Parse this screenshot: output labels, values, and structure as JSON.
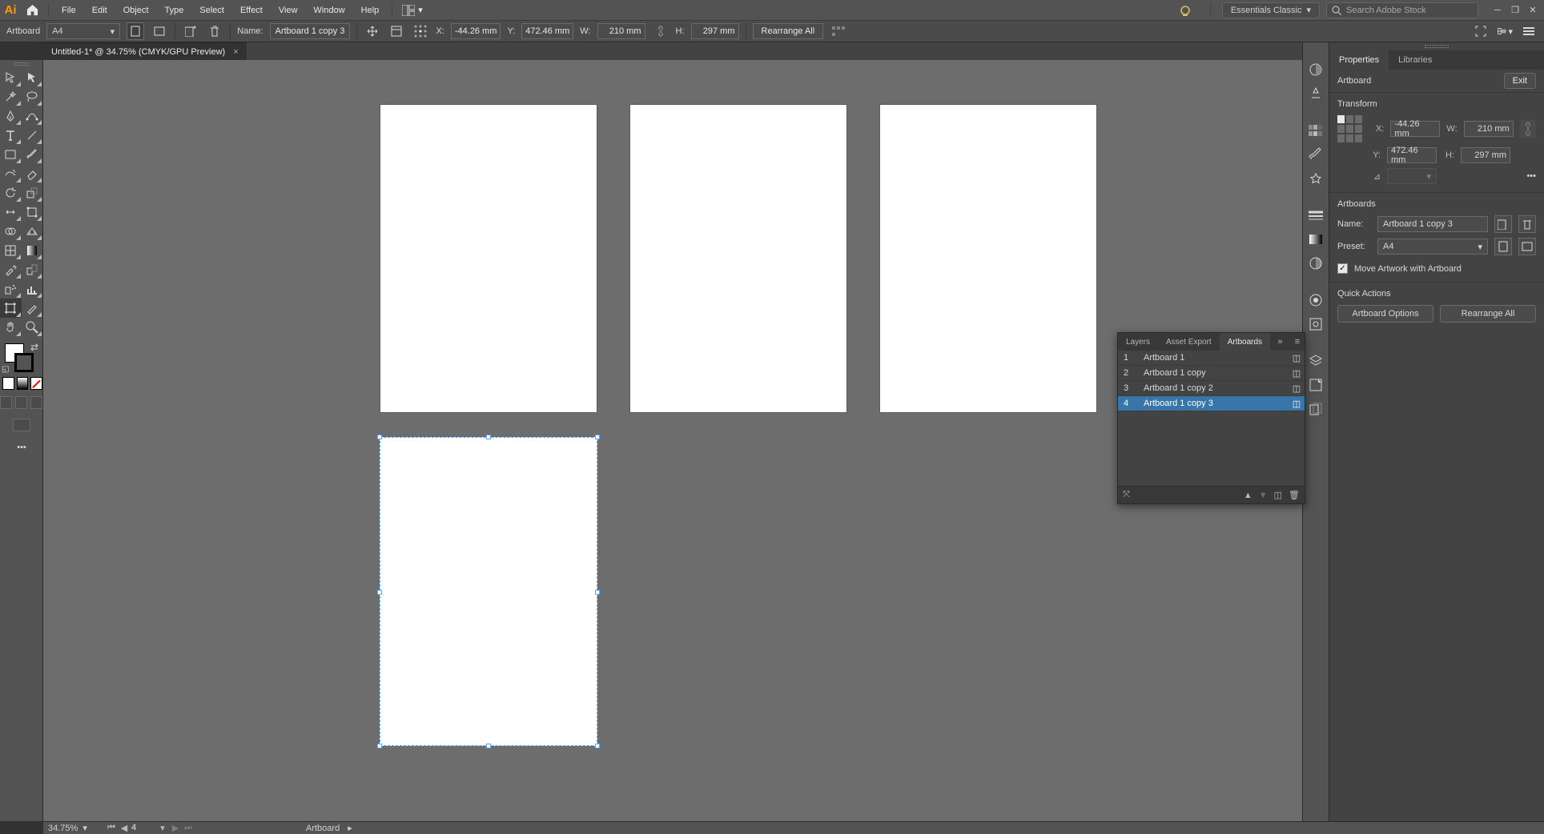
{
  "menubar": {
    "items": [
      "File",
      "Edit",
      "Object",
      "Type",
      "Select",
      "Effect",
      "View",
      "Window",
      "Help"
    ],
    "workspace": "Essentials Classic",
    "search_placeholder": "Search Adobe Stock"
  },
  "ctrlbar": {
    "sel_label": "Artboard",
    "preset": "A4",
    "name_label": "Name:",
    "name": "Artboard 1 copy 3",
    "x_label": "X:",
    "x": "-44.26 mm",
    "y_label": "Y:",
    "y": "472.46 mm",
    "w_label": "W:",
    "w": "210 mm",
    "h_label": "H:",
    "h": "297 mm",
    "rearrange": "Rearrange All"
  },
  "doc_tab": "Untitled-1* @ 34.75% (CMYK/GPU Preview)",
  "status": {
    "zoom": "34.75%",
    "page": "4",
    "tool": "Artboard"
  },
  "properties": {
    "tab_prop": "Properties",
    "tab_lib": "Libraries",
    "object": "Artboard",
    "exit": "Exit",
    "section_transform": "Transform",
    "x": "-44.26 mm",
    "y": "472.46 mm",
    "w": "210 mm",
    "h": "297 mm",
    "section_artboards": "Artboards",
    "name_label": "Name:",
    "name": "Artboard 1 copy 3",
    "preset_label": "Preset:",
    "preset": "A4",
    "move_artwork_label": "Move Artwork with Artboard",
    "section_quick": "Quick Actions",
    "action1": "Artboard Options",
    "action2": "Rearrange All"
  },
  "abpanel": {
    "tabs": [
      "Layers",
      "Asset Export",
      "Artboards"
    ],
    "rows": [
      {
        "n": "1",
        "name": "Artboard 1",
        "sel": false
      },
      {
        "n": "2",
        "name": "Artboard 1 copy",
        "sel": false
      },
      {
        "n": "3",
        "name": "Artboard 1 copy 2",
        "sel": false
      },
      {
        "n": "4",
        "name": "Artboard 1 copy 3",
        "sel": true
      }
    ]
  }
}
